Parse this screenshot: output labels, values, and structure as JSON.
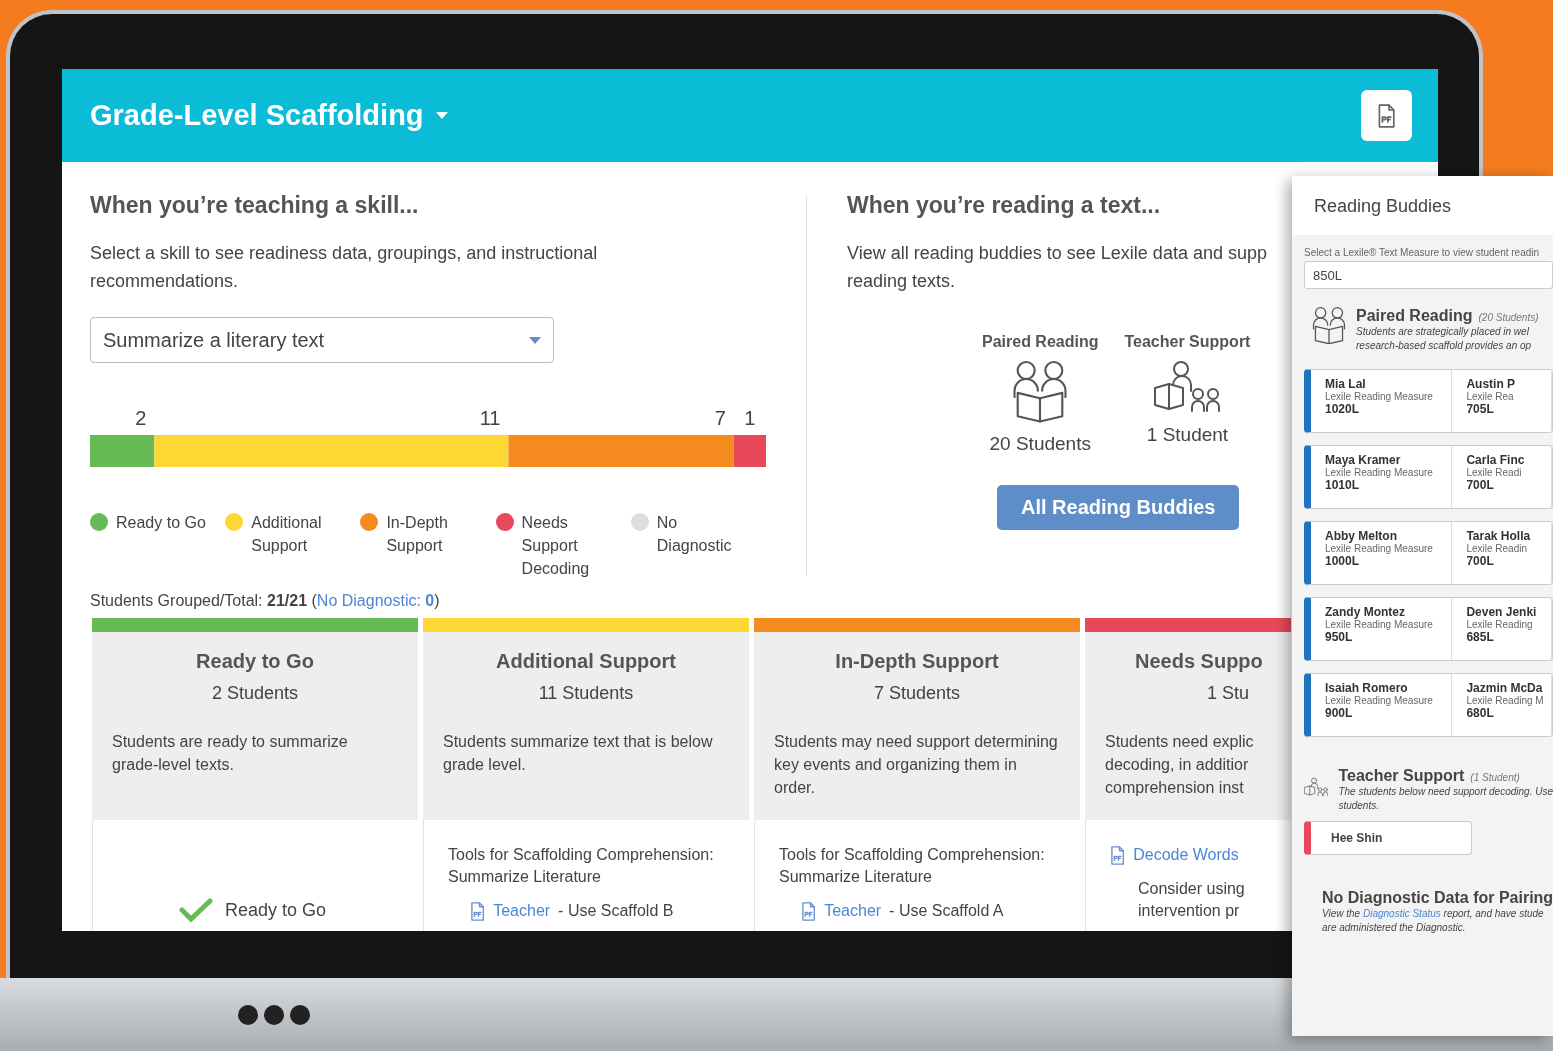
{
  "header": {
    "title": "Grade-Level Scaffolding"
  },
  "skill": {
    "heading": "When you’re teaching a skill...",
    "description": "Select a skill to see readiness data, groupings, and instructional recommendations.",
    "select_value": "Summarize a literary text",
    "chart_data": {
      "type": "bar",
      "orientation": "horizontal",
      "stacked": true,
      "data_labels": true,
      "xlim": [
        0,
        21
      ],
      "series": [
        {
          "name": "Ready to Go",
          "color": "#66bb55",
          "values": [
            2
          ]
        },
        {
          "name": "Additional Support",
          "color": "#fdd835",
          "values": [
            11
          ]
        },
        {
          "name": "In-Depth Support",
          "color": "#f58a1f",
          "values": [
            7
          ]
        },
        {
          "name": "Needs Support Decoding",
          "color": "#e8495a",
          "values": [
            1
          ]
        },
        {
          "name": "No Diagnostic",
          "color": "#dddddd",
          "values": [
            null
          ]
        }
      ]
    }
  },
  "reading": {
    "heading": "When you’re reading a text...",
    "description_lines": [
      "View all reading buddies to see Lexile data and supp",
      "reading texts."
    ],
    "groups": [
      {
        "kind": "paired",
        "title": "Paired Reading",
        "count": "20 Students"
      },
      {
        "kind": "teacher",
        "title": "Teacher Support",
        "count": "1 Student"
      }
    ],
    "button": "All Reading Buddies"
  },
  "summary": {
    "text": "Students Grouped/Total: **21/21** (",
    "link": "No Diagnostic: **0**",
    "close": ")"
  },
  "cards": [
    {
      "kind": "ready",
      "color": "#66bb55",
      "title": "Ready to Go",
      "count": "2 Students",
      "description": "Students are ready to summarize grade-level texts.",
      "status": "Ready to Go"
    },
    {
      "kind": "tools",
      "color": "#fdd835",
      "title": "Additional Support",
      "count": "11 Students",
      "description": "Students summarize text that is below grade level.",
      "tools_title": "Tools for Scaffolding Comprehension: Summarize Literature",
      "link": "Teacher",
      "link_suffix": "- Use Scaffold B"
    },
    {
      "kind": "tools",
      "color": "#f58a1f",
      "title": "In-Depth Support",
      "count": "7 Students",
      "description": "Students may need support determining key events and organizing them in order.",
      "tools_title": "Tools for Scaffolding Comprehension: Summarize Literature",
      "link": "Teacher",
      "link_suffix": "- Use Scaffold A"
    },
    {
      "kind": "decode",
      "color": "#e8495a",
      "title": "Needs Suppo",
      "count": "1 Stu",
      "description_lines": [
        "Students need explic",
        "decoding, in additior",
        "comprehension inst"
      ],
      "link": "Decode Words",
      "note_lines": [
        "Consider using",
        "intervention pr"
      ]
    }
  ],
  "panel": {
    "title": "Reading Buddies",
    "field_label": "Select a Lexile® Text Measure to view student readin",
    "field_value": "850L",
    "paired": {
      "title": "Paired Reading",
      "count": "(20 Students)",
      "lines": [
        "Students are strategically placed in wel",
        "research-based scaffold provides an op"
      ],
      "pairs": [
        [
          {
            "name": "Mia Lal",
            "label": "Lexile Reading Measure",
            "measure": "1020L"
          },
          {
            "name": "Austin P",
            "label": "Lexile Rea",
            "measure": "705L"
          }
        ],
        [
          {
            "name": "Maya Kramer",
            "label": "Lexile Reading Measure",
            "measure": "1010L"
          },
          {
            "name": "Carla Finc",
            "label": "Lexile Readi",
            "measure": "700L"
          }
        ],
        [
          {
            "name": "Abby Melton",
            "label": "Lexile Reading Measure",
            "measure": "1000L"
          },
          {
            "name": "Tarak Holla",
            "label": "Lexile Readin",
            "measure": "700L"
          }
        ],
        [
          {
            "name": "Zandy Montez",
            "label": "Lexile Reading Measure",
            "measure": "950L"
          },
          {
            "name": "Deven Jenki",
            "label": "Lexile Reading",
            "measure": "685L"
          }
        ],
        [
          {
            "name": "Isaiah Romero",
            "label": "Lexile Reading Measure",
            "measure": "900L"
          },
          {
            "name": "Jazmin McDa",
            "label": "Lexile Reading M",
            "measure": "680L"
          }
        ]
      ]
    },
    "teacher": {
      "title": "Teacher Support",
      "count": "(1 Student)",
      "lines": [
        "The students below need support decoding. Use",
        "students."
      ],
      "students": [
        "Hee Shin"
      ]
    },
    "no_diagnostic": {
      "title": "No Diagnostic Data for Pairing",
      "before": "View the",
      "link": "Diagnostic Status",
      "after": "report, and have stude",
      "line2": "are administered the Diagnostic."
    }
  }
}
